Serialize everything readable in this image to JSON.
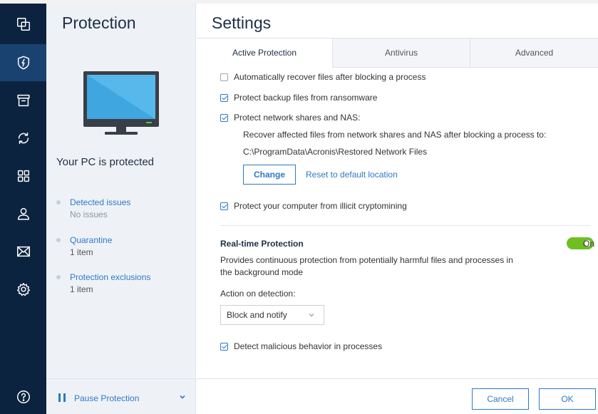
{
  "nav": {
    "items": [
      {
        "icon": "copy-icon"
      },
      {
        "icon": "shield-icon",
        "active": true
      },
      {
        "icon": "archive-icon"
      },
      {
        "icon": "sync-icon"
      },
      {
        "icon": "grid-icon"
      },
      {
        "icon": "user-icon"
      },
      {
        "icon": "mail-icon"
      },
      {
        "icon": "gear-icon"
      },
      {
        "icon": "help-icon"
      }
    ]
  },
  "panel": {
    "title": "Protection",
    "status": "Your PC is protected",
    "stats": [
      {
        "label": "Detected issues",
        "value": "No issues"
      },
      {
        "label": "Quarantine",
        "value": "1 item"
      },
      {
        "label": "Protection exclusions",
        "value": "1 item"
      }
    ],
    "pause_label": "Pause Protection"
  },
  "settings": {
    "title": "Settings",
    "tabs": [
      {
        "label": "Active Protection",
        "active": true
      },
      {
        "label": "Antivirus"
      },
      {
        "label": "Advanced"
      }
    ],
    "options": {
      "auto_recover": {
        "label": "Automatically recover files after blocking a process",
        "checked": false
      },
      "protect_backup": {
        "label": "Protect backup files from ransomware",
        "checked": true
      },
      "protect_network": {
        "label": "Protect network shares and NAS:",
        "checked": true
      },
      "recover_text": "Recover affected files from network shares and NAS after blocking a process to:",
      "recover_path": "C:\\ProgramData\\Acronis\\Restored Network Files",
      "change_button": "Change",
      "reset_link": "Reset to default location",
      "cryptomining": {
        "label": "Protect your computer from illicit cryptomining",
        "checked": true
      }
    },
    "realtime": {
      "title": "Real-time Protection",
      "toggle_label": "On",
      "enabled": true,
      "description": "Provides continuous protection from potentially harmful files and processes in the background mode",
      "action_label": "Action on detection:",
      "action_value": "Block and notify",
      "detect_malicious": {
        "label": "Detect malicious behavior in processes",
        "checked": true
      }
    },
    "buttons": {
      "cancel": "Cancel",
      "ok": "OK"
    }
  },
  "colors": {
    "nav_bg": "#0c2340",
    "nav_active": "#1a4270",
    "accent": "#2f79c6",
    "toggle_on": "#6fbf22",
    "panel_bg": "#eef2f6"
  }
}
